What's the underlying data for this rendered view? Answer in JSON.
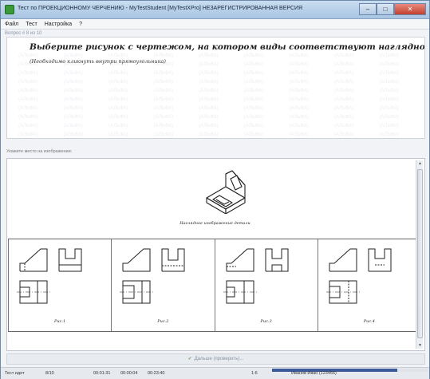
{
  "window": {
    "title": "Тест по ПРОЕКЦИОННОМУ ЧЕРЧЕНИЮ - MyTestStudent [MyTestXPro] НЕЗАРЕГИСТРИРОВАННАЯ ВЕРСИЯ",
    "min_glyph": "–",
    "max_glyph": "□",
    "close_glyph": "✕"
  },
  "menu": [
    "Файл",
    "Тест",
    "Настройка",
    "?"
  ],
  "question": {
    "number": "Вопрос # 8 из 10",
    "text": "Выберите рисунок с чертежом, на котором виды соответствуют наглядно изображённой детали",
    "hint": "(Необходимо кликнуть внутри прямоугольника)",
    "watermark": "(АЛЬФА)"
  },
  "instruction": "Укажите место на изображении:",
  "figure": {
    "caption": "Наглядное изображение детали",
    "options": [
      {
        "label": "Рис.1"
      },
      {
        "label": "Рис.2"
      },
      {
        "label": "Рис.3"
      },
      {
        "label": "Рис.4"
      }
    ]
  },
  "next_button": "Дальше (проверить)...",
  "status": {
    "label": "Тест идет",
    "count": "8/10",
    "time_total": "00:01:31",
    "time_question": "00:00:04",
    "time_left": "00:23:40",
    "ratio": "1:6",
    "user": "Иванов Иван (123456)",
    "progress_fraction": 0.8
  }
}
